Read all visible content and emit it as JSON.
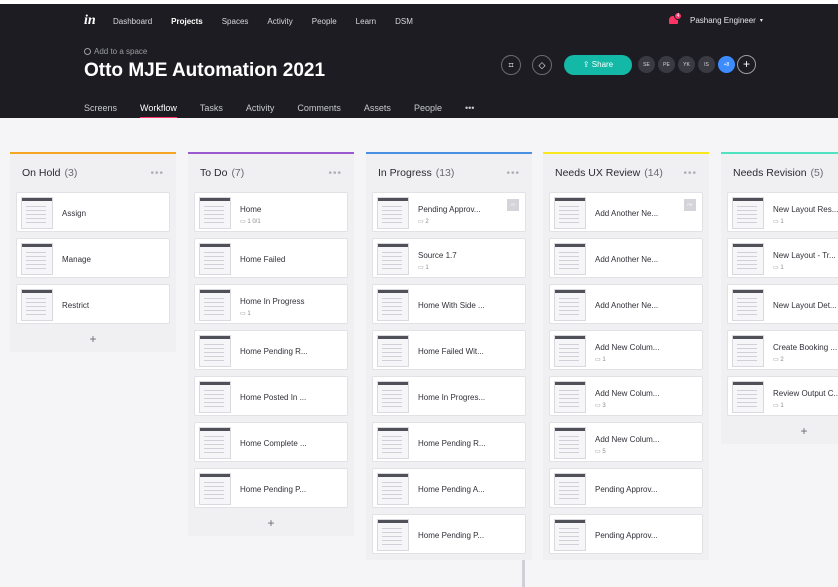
{
  "nav": {
    "logo": "in",
    "items": [
      "Dashboard",
      "Projects",
      "Spaces",
      "Activity",
      "People",
      "Learn",
      "DSM"
    ],
    "active": "Projects"
  },
  "user": {
    "name": "Pashang Engineer",
    "notifications": "4"
  },
  "project": {
    "add_to_space": "Add to a space",
    "title": "Otto MJE Automation 2021"
  },
  "tabs": [
    "Screens",
    "Workflow",
    "Tasks",
    "Activity",
    "Comments",
    "Assets",
    "People"
  ],
  "tabs_more": "•••",
  "active_tab": "Workflow",
  "share_label": "Share",
  "avatars": [
    "SE",
    "PE",
    "YK",
    "IS",
    "+8"
  ],
  "accent": "#ff3366",
  "share_color": "#14b8a6",
  "columns": [
    {
      "title": "On Hold",
      "count": "(3)",
      "color": "#f5a623",
      "add": "+",
      "cards": [
        {
          "title": "Assign"
        },
        {
          "title": "Manage"
        },
        {
          "title": "Restrict"
        }
      ]
    },
    {
      "title": "To Do",
      "count": "(7)",
      "color": "#9b59d0",
      "add": "+",
      "cards": [
        {
          "title": "Home",
          "meta": "1    0/1"
        },
        {
          "title": "Home Failed"
        },
        {
          "title": "Home In Progress",
          "meta": "1"
        },
        {
          "title": "Home Pending R..."
        },
        {
          "title": "Home Posted In ..."
        },
        {
          "title": "Home Complete ..."
        },
        {
          "title": "Home Pending P..."
        }
      ]
    },
    {
      "title": "In Progress",
      "count": "(13)",
      "color": "#4a90e2",
      "cards": [
        {
          "title": "Pending Approv...",
          "meta": "2",
          "badge": "IS"
        },
        {
          "title": "Source 1.7",
          "meta": "1"
        },
        {
          "title": "Home With Side ..."
        },
        {
          "title": "Home Failed Wit..."
        },
        {
          "title": "Home In Progres..."
        },
        {
          "title": "Home Pending R..."
        },
        {
          "title": "Home Pending A..."
        },
        {
          "title": "Home Pending P..."
        }
      ]
    },
    {
      "title": "Needs UX Review",
      "count": "(14)",
      "color": "#f8e71c",
      "cards": [
        {
          "title": "Add Another  Ne...",
          "badge": "PE"
        },
        {
          "title": "Add Another Ne..."
        },
        {
          "title": "Add Another Ne..."
        },
        {
          "title": "Add New Colum...",
          "meta": "1"
        },
        {
          "title": "Add New Colum...",
          "meta": "3"
        },
        {
          "title": "Add New Colum...",
          "meta": "5"
        },
        {
          "title": "Pending Approv..."
        },
        {
          "title": "Pending Approv..."
        }
      ]
    },
    {
      "title": "Needs Revision",
      "count": "(5)",
      "color": "#50e3c2",
      "add": "+",
      "cards": [
        {
          "title": "New Layout Res...",
          "meta": "1"
        },
        {
          "title": "New Layout - Tr...",
          "meta": "1"
        },
        {
          "title": "New Layout Det..."
        },
        {
          "title": "Create Booking ...",
          "meta": "2"
        },
        {
          "title": "Review Output C...",
          "meta": "1"
        }
      ]
    }
  ]
}
